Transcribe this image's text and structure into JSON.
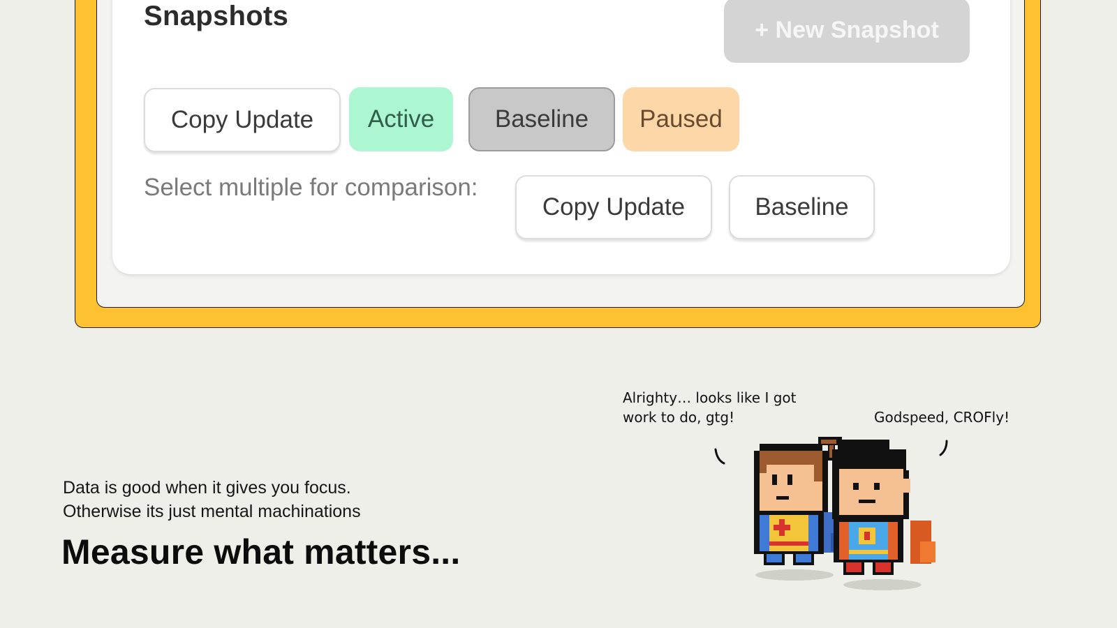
{
  "snapshots_panel": {
    "title": "Snapshots",
    "new_snapshot_button": "+ New Snapshot",
    "status_chips": [
      {
        "label": "Copy Update",
        "style": "outline"
      },
      {
        "label": "Active",
        "style": "active",
        "color": "#adf6d2"
      },
      {
        "label": "Baseline",
        "style": "selected",
        "color": "#c8c8c8"
      },
      {
        "label": "Paused",
        "style": "paused",
        "color": "#fed7a8"
      }
    ],
    "compare_label": "Select multiple for comparison:",
    "compare_chips": [
      "Copy Update",
      "Baseline"
    ]
  },
  "caption": {
    "line1": "Data is good when it gives you focus.",
    "line2": "Otherwise its just mental machinations",
    "headline": "Measure what matters..."
  },
  "comic": {
    "speech_left_line1": "Alrighty… looks like I got",
    "speech_left_line2": "work to do, gtg!",
    "speech_right": "Godspeed, CROFly!"
  },
  "colors": {
    "background": "#edefe8",
    "frame": "#fec12f"
  }
}
